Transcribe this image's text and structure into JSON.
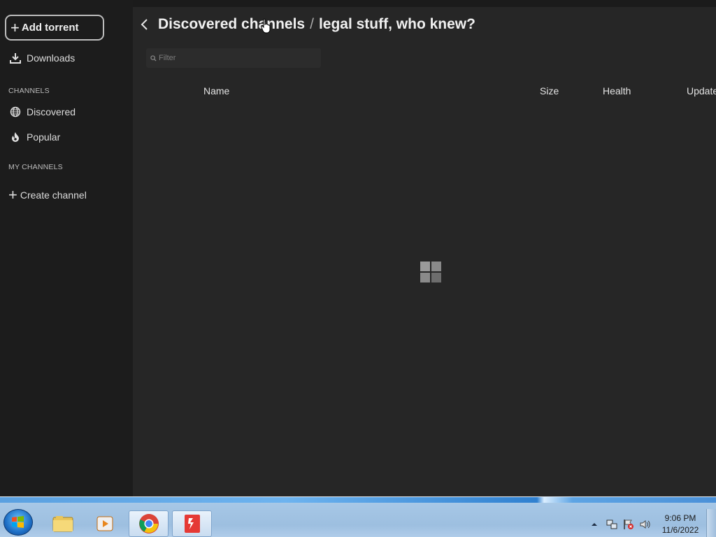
{
  "sidebar": {
    "add_torrent": "Add torrent",
    "downloads": "Downloads",
    "channels_heading": "CHANNELS",
    "discovered": "Discovered",
    "popular": "Popular",
    "my_channels_heading": "MY CHANNELS",
    "create_channel": "Create channel"
  },
  "header": {
    "parent": "Discovered channels",
    "separator": "/",
    "current": "legal stuff, who knew?"
  },
  "filter": {
    "placeholder": "Filter",
    "value": ""
  },
  "table": {
    "columns": [
      "Name",
      "Size",
      "Health",
      "Updated"
    ]
  },
  "taskbar": {
    "apps": [
      "start-orb",
      "windows-explorer",
      "media-player",
      "google-chrome",
      "tribler"
    ],
    "clock_time": "9:06 PM",
    "clock_date": "11/6/2022"
  },
  "colors": {
    "sidebar_bg": "#1c1c1c",
    "main_bg": "#262626",
    "text": "#e6e6e6"
  }
}
